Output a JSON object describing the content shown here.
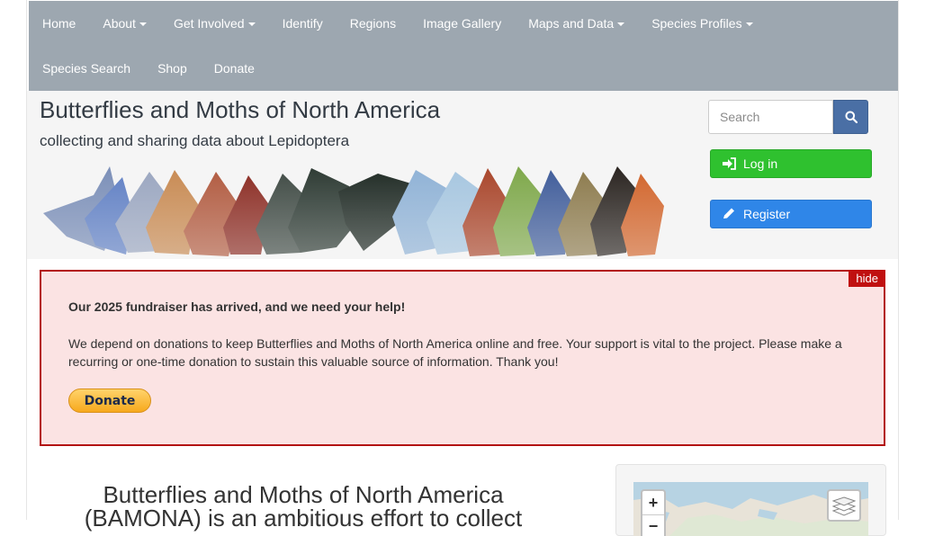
{
  "nav": {
    "row1": [
      {
        "label": "Home",
        "dropdown": false
      },
      {
        "label": "About",
        "dropdown": true
      },
      {
        "label": "Get Involved",
        "dropdown": true
      },
      {
        "label": "Identify",
        "dropdown": false
      },
      {
        "label": "Regions",
        "dropdown": false
      },
      {
        "label": "Image Gallery",
        "dropdown": false
      },
      {
        "label": "Maps and Data",
        "dropdown": true
      },
      {
        "label": "Species Profiles",
        "dropdown": true
      }
    ],
    "row2": [
      {
        "label": "Species Search",
        "dropdown": false
      },
      {
        "label": "Shop",
        "dropdown": false
      },
      {
        "label": "Donate",
        "dropdown": false
      }
    ]
  },
  "header": {
    "title": "Butterflies and Moths of North America",
    "tagline": "collecting and sharing data about Lepidoptera"
  },
  "search": {
    "placeholder": "Search",
    "icon": "search-icon"
  },
  "auth": {
    "login_label": "Log in",
    "login_icon": "sign-in-icon",
    "register_label": "Register",
    "register_icon": "pencil-icon"
  },
  "alert": {
    "hide_label": "hide",
    "heading": "Our 2025 fundraiser has arrived, and we need your help!",
    "body": "We depend on donations to keep Butterflies and Moths of North America online and free. Your support is vital to the project. Please make a recurring or one-time donation to sustain this valuable source of information. Thank you!",
    "donate_label": "Donate"
  },
  "intro": {
    "text": "Butterflies and Moths of North America (BAMONA) is an ambitious effort to collect"
  },
  "map": {
    "zoom_in": "+",
    "zoom_out": "−",
    "layers_icon": "layers-icon"
  },
  "colors": {
    "navbar": "#9da7b0",
    "login": "#2fc12f",
    "register": "#2f86e8",
    "alert_border": "#b31212",
    "alert_bg": "#fbe3e3"
  }
}
